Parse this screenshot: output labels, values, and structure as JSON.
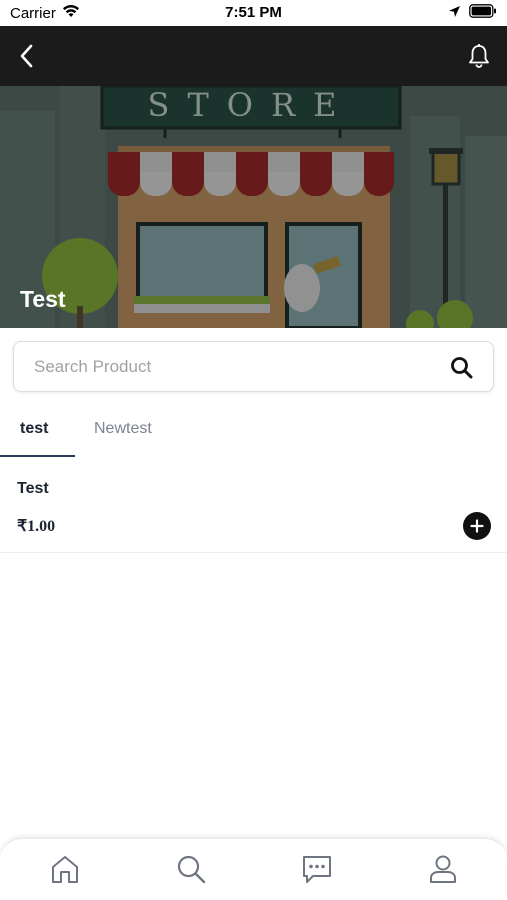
{
  "status_bar": {
    "carrier": "Carrier",
    "time": "7:51 PM",
    "icons": [
      "wifi-icon",
      "location-arrow-icon",
      "battery-icon"
    ]
  },
  "nav_bar": {
    "icons": [
      "back-chevron-icon",
      "bell-icon"
    ]
  },
  "banner": {
    "sign_text": "STORE",
    "store_name": "Test"
  },
  "search": {
    "placeholder": "Search Product",
    "value": ""
  },
  "tabs": [
    {
      "label": "test",
      "active": true
    },
    {
      "label": "Newtest",
      "active": false
    }
  ],
  "products": [
    {
      "name": "Test",
      "price": "₹1.00"
    }
  ],
  "bottom_nav": {
    "items": [
      "home-icon",
      "search-icon",
      "chat-icon",
      "profile-icon"
    ]
  },
  "colors": {
    "nav_background": "#1b1b1b",
    "accent": "#2a3a5a",
    "inactive_tab": "#7c8391",
    "icon_gray": "#6f7580"
  }
}
